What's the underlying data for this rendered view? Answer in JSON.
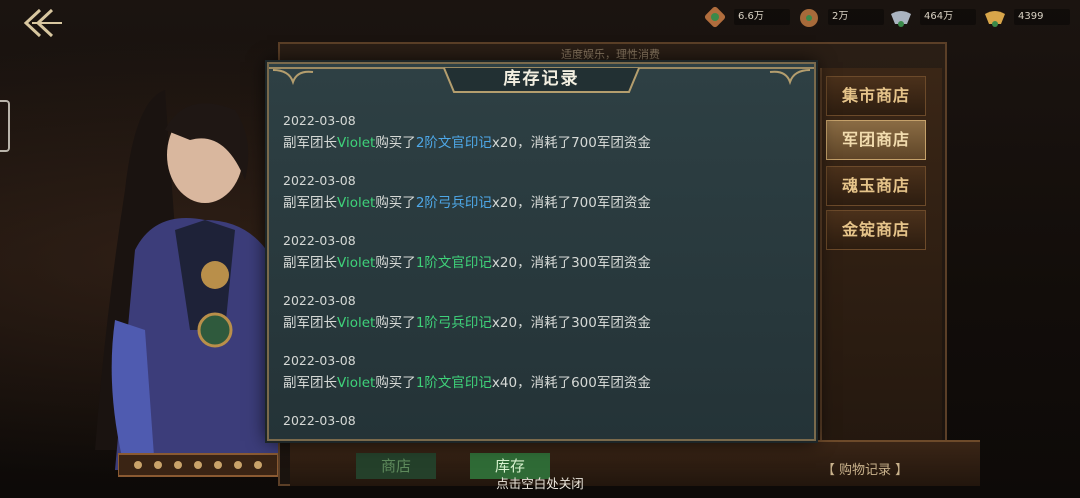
{
  "top_bar": {
    "resources": [
      {
        "icon": "bronze-seal-icon",
        "value": "6.6万"
      },
      {
        "icon": "copper-coin-pouch-icon",
        "value": "2万"
      },
      {
        "icon": "silver-ingot-icon",
        "value": "464万"
      },
      {
        "icon": "gold-ingot-icon",
        "value": "4399"
      }
    ]
  },
  "notice": "适度娱乐，理性消费",
  "modal": {
    "title": "库存记录",
    "records": [
      {
        "date": "2022-03-08",
        "prefix": "副军团长",
        "name": "Violet",
        "verb": "购买了",
        "item": "2阶文官印记",
        "item_color": "blue",
        "qty": "x20",
        "suffix": "，消耗了700军团资金"
      },
      {
        "date": "2022-03-08",
        "prefix": "副军团长",
        "name": "Violet",
        "verb": "购买了",
        "item": "2阶弓兵印记",
        "item_color": "blue",
        "qty": "x20",
        "suffix": "，消耗了700军团资金"
      },
      {
        "date": "2022-03-08",
        "prefix": "副军团长",
        "name": "Violet",
        "verb": "购买了",
        "item": "1阶文官印记",
        "item_color": "green",
        "qty": "x20",
        "suffix": "，消耗了300军团资金"
      },
      {
        "date": "2022-03-08",
        "prefix": "副军团长",
        "name": "Violet",
        "verb": "购买了",
        "item": "1阶弓兵印记",
        "item_color": "green",
        "qty": "x20",
        "suffix": "，消耗了300军团资金"
      },
      {
        "date": "2022-03-08",
        "prefix": "副军团长",
        "name": "Violet",
        "verb": "购买了",
        "item": "1阶文官印记",
        "item_color": "green",
        "qty": "x40",
        "suffix": "，消耗了600军团资金"
      },
      {
        "date": "2022-03-08"
      }
    ]
  },
  "shop_tabs": [
    {
      "label": "集市商店",
      "active": false
    },
    {
      "label": "军团商店",
      "active": true
    },
    {
      "label": "魂玉商店",
      "active": false
    },
    {
      "label": "金锭商店",
      "active": false
    }
  ],
  "bottom_tabs": {
    "store": "商店",
    "stock": "库存"
  },
  "purchase_record": "【 购物记录 】",
  "close_hint": "点击空白处关闭",
  "colors": {
    "name": "#3fd27a",
    "item_blue": "#4ea8e8",
    "item_green": "#3fd27a",
    "modal_bg": "#2b3c40"
  }
}
